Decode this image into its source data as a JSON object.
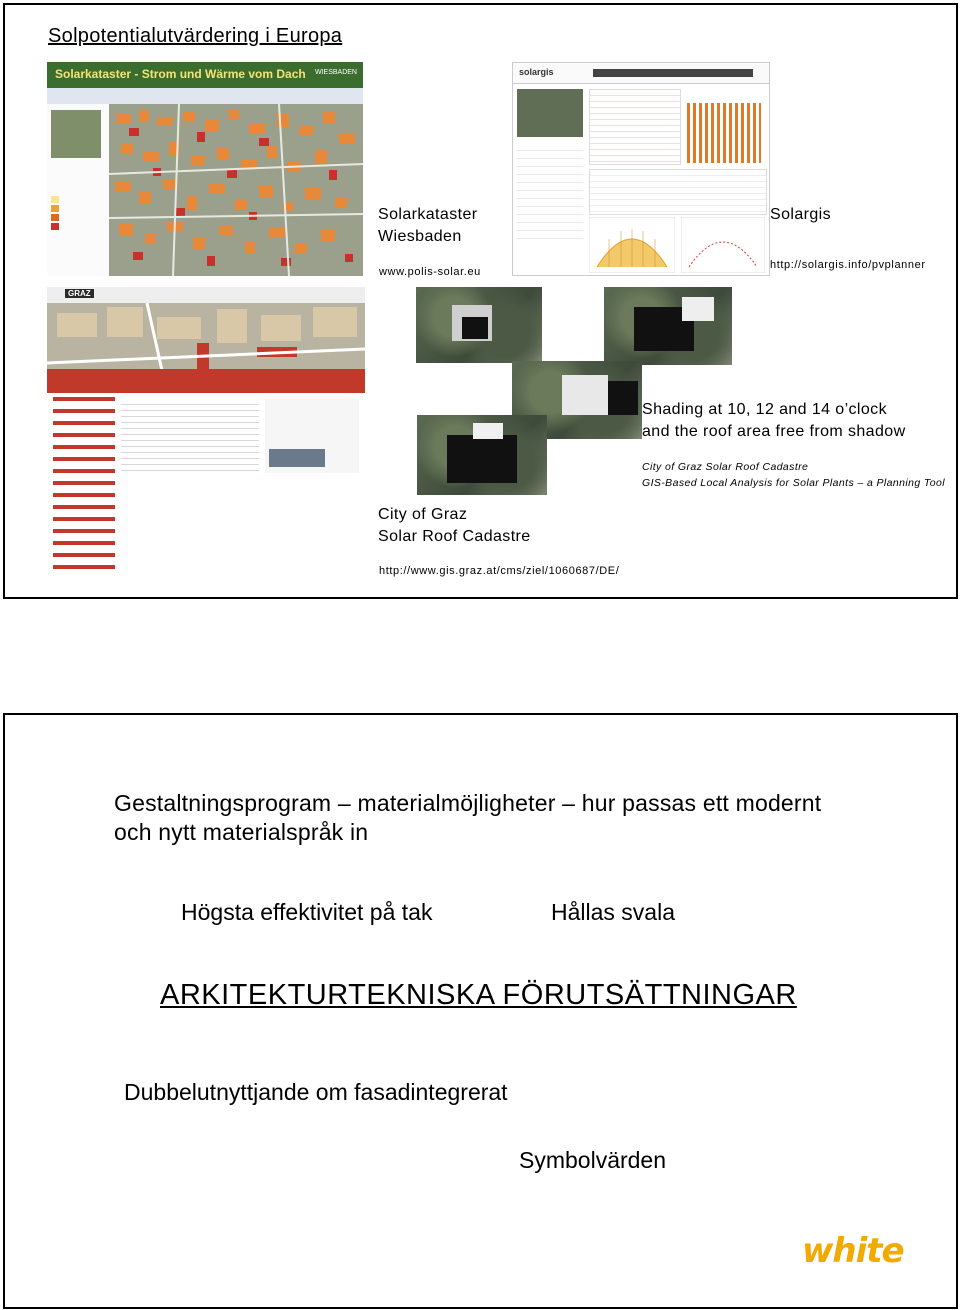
{
  "slide1": {
    "title": "Solpotentialutvärdering i Europa",
    "wiesbaden": {
      "label_line1": "Solarkataster",
      "label_line2": "Wiesbaden",
      "url": "www.polis-solar.eu",
      "screenshot_header": "Solarkataster - Strom und Wärme vom Dach",
      "screenshot_logo": "WIESBADEN"
    },
    "solargis": {
      "label": "Solargis",
      "url": "http://solargis.info/pvplanner",
      "screenshot_brand": "solargis"
    },
    "graz": {
      "label_line1": "City of Graz",
      "label_line2": "Solar Roof Cadastre",
      "url": "http://www.gis.graz.at/cms/ziel/1060687/DE/",
      "screenshot_logo": "GRAZ"
    },
    "shading": {
      "line1": "Shading at 10, 12 and 14 o’clock",
      "line2": "and the roof area free from shadow",
      "caption1": "City of Graz Solar Roof Cadastre",
      "caption2": "GIS-Based Local Analysis for Solar Plants – a Planning Tool"
    }
  },
  "slide2": {
    "heading_line1": "Gestaltningsprogram – materialmöjligheter – hur passas ett modernt",
    "heading_line2": "och nytt materialspråk in",
    "item_left": "Högsta effektivitet på tak",
    "item_right": "Hållas svala",
    "main_title": "ARKITEKTURTEKNISKA FÖRUTSÄTTNINGAR",
    "line_dubbel": "Dubbelutnyttjande om fasadintegrerat",
    "line_symbol": "Symbolvärden",
    "logo": "white"
  },
  "colors": {
    "roof_orange": "#e8893a",
    "roof_red": "#c9302c",
    "graz_red": "#c0392b",
    "logo_yellow": "#f2a900"
  }
}
